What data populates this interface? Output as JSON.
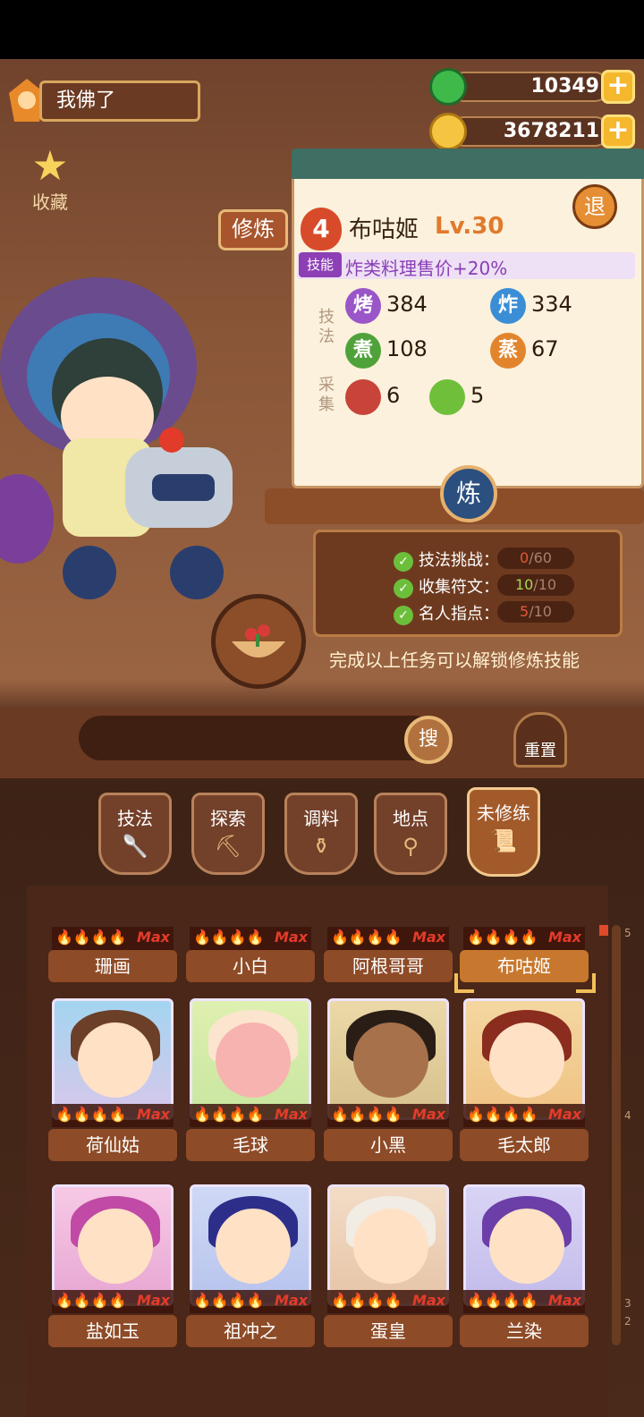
{
  "player": {
    "name": "我佛了"
  },
  "favorites": {
    "label": "收藏"
  },
  "currency": {
    "jade": "10349",
    "coins": "3678211"
  },
  "panel": {
    "tag": "修炼",
    "rank": "4",
    "name": "布咕姬",
    "level": "Lv.30",
    "exit": "退",
    "skill_label": "技能",
    "skill_text": "炸类料理售价+20%",
    "skill_section": "技法",
    "gather_section": "采集",
    "stats": {
      "grill_icon": "烤",
      "grill": "384",
      "fry_icon": "炸",
      "fry": "334",
      "boil_icon": "煮",
      "boil": "108",
      "steam_icon": "蒸",
      "steam": "67",
      "meat": "6",
      "veg": "5"
    },
    "refine": "炼"
  },
  "tasks": [
    {
      "label": "技法挑战：",
      "progress": "0/60",
      "done": "0",
      "total": "/60"
    },
    {
      "label": "收集符文：",
      "progress": "10/10",
      "done": "10",
      "total": "/10"
    },
    {
      "label": "名人指点：",
      "progress": "5/10",
      "done": "5",
      "total": "/10"
    }
  ],
  "tasks_hint": "完成以上任务可以解锁修炼技能",
  "search": {
    "button": "搜",
    "reset": "重置"
  },
  "tabs": [
    "技法",
    "探索",
    "调料",
    "地点",
    "未修练"
  ],
  "cards": {
    "row1": [
      "珊画",
      "小白",
      "阿根哥哥",
      "布咕姬"
    ],
    "row2": [
      "荷仙姑",
      "毛球",
      "小黑",
      "毛太郎"
    ],
    "row3": [
      "盐如玉",
      "祖冲之",
      "蛋皇",
      "兰染"
    ],
    "max_label": "Max"
  },
  "scroll_marks": [
    "5",
    "4",
    "3",
    "2"
  ],
  "colors": {
    "accent": "#e07a2c",
    "panel_bg": "#fbf1dc",
    "wood": "#8e4b27"
  }
}
